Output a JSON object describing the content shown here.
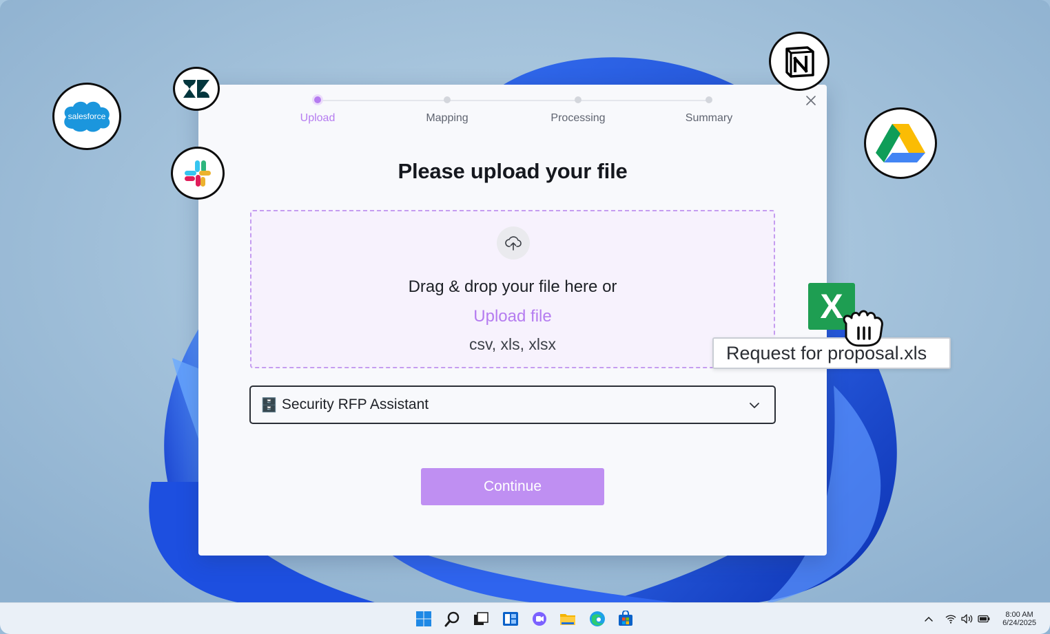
{
  "stepper": {
    "steps": [
      {
        "label": "Upload",
        "active": true
      },
      {
        "label": "Mapping",
        "active": false
      },
      {
        "label": "Processing",
        "active": false
      },
      {
        "label": "Summary",
        "active": false
      }
    ]
  },
  "dialog": {
    "title": "Please upload your file",
    "dropzone": {
      "instruction": "Drag & drop your file here or",
      "link_label": "Upload file",
      "file_types": "csv, xls, xlsx"
    },
    "select": {
      "icon": "🗄️",
      "value": "Security RFP Assistant"
    },
    "continue_label": "Continue"
  },
  "integrations": [
    "salesforce",
    "zendesk",
    "slack",
    "notion",
    "google-drive"
  ],
  "salesforce_text": "salesforce",
  "dragged_file": {
    "name": "Request for proposal.xls",
    "icon_letter": "X"
  },
  "taskbar": {
    "time": "8:00 AM",
    "date": "6/24/2025"
  },
  "colors": {
    "accent": "#b57cf0",
    "button": "#bf8ff2",
    "excel_green": "#1e9e52"
  }
}
